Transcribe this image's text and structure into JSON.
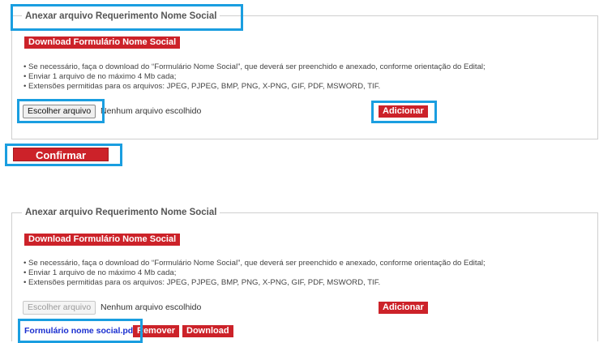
{
  "colors": {
    "accent_red": "#cc2229",
    "highlight_blue": "#1a9ee0",
    "link_blue": "#1a2fd0"
  },
  "section_title": "Anexar arquivo Requerimento Nome Social",
  "download_form_label": "Download Formulário Nome Social",
  "instructions": [
    "• Se necessário, faça o download do “Formulário Nome Social”, que deverá ser preenchido e anexado, conforme orientação do Edital;",
    "• Enviar 1 arquivo de no máximo 4 Mb cada;",
    "• Extensões permitidas para os arquivos: JPEG, PJPEG, BMP, PNG, X-PNG, GIF, PDF, MSWORD, TIF."
  ],
  "choose_file_label": "Escolher arquivo",
  "no_file_text": "Nenhum arquivo escolhido",
  "add_label": "Adicionar",
  "confirm_label": "Confirmar",
  "attached_file": {
    "name": "Formulário nome social.pdf",
    "remove_label": "Remover",
    "download_label": "Download"
  }
}
